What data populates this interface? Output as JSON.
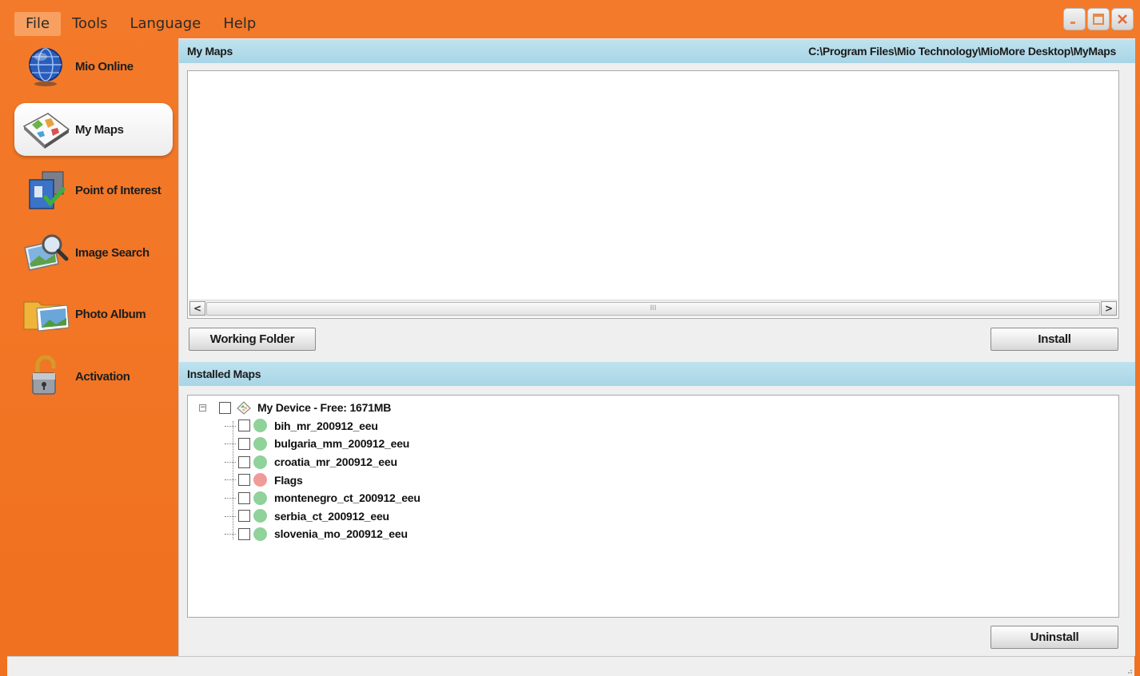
{
  "menu": {
    "items": [
      {
        "label": "File",
        "active": true
      },
      {
        "label": "Tools",
        "active": false
      },
      {
        "label": "Language",
        "active": false
      },
      {
        "label": "Help",
        "active": false
      }
    ]
  },
  "window_controls": {
    "minimize": "minimize-icon",
    "maximize": "maximize-icon",
    "close": "close-icon"
  },
  "sidebar": {
    "items": [
      {
        "label": "Mio Online",
        "icon": "globe-icon",
        "active": false
      },
      {
        "label": "My Maps",
        "icon": "map-icon",
        "active": true
      },
      {
        "label": "Point of Interest",
        "icon": "poi-icon",
        "active": false
      },
      {
        "label": "Image Search",
        "icon": "image-search-icon",
        "active": false
      },
      {
        "label": "Photo Album",
        "icon": "photo-album-icon",
        "active": false
      },
      {
        "label": "Activation",
        "icon": "padlock-icon",
        "active": false
      }
    ]
  },
  "my_maps": {
    "title": "My Maps",
    "path": "C:\\Program Files\\Mio Technology\\MioMore Desktop\\MyMaps",
    "working_folder_label": "Working Folder",
    "install_label": "Install",
    "scroll_grip": "III"
  },
  "installed_maps": {
    "title": "Installed Maps",
    "root_label": "My Device - Free: 1671MB",
    "root_expander": "−",
    "items": [
      {
        "label": "bih_mr_200912_eeu",
        "status_color": "#8fd29a"
      },
      {
        "label": "bulgaria_mm_200912_eeu",
        "status_color": "#8fd29a"
      },
      {
        "label": "croatia_mr_200912_eeu",
        "status_color": "#8fd29a"
      },
      {
        "label": "Flags",
        "status_color": "#f19a9a"
      },
      {
        "label": "montenegro_ct_200912_eeu",
        "status_color": "#8fd29a"
      },
      {
        "label": "serbia_ct_200912_eeu",
        "status_color": "#8fd29a"
      },
      {
        "label": "slovenia_mo_200912_eeu",
        "status_color": "#8fd29a"
      }
    ],
    "uninstall_label": "Uninstall"
  },
  "colors": {
    "accent": "#f37a2a",
    "header": "#b5dcea"
  }
}
